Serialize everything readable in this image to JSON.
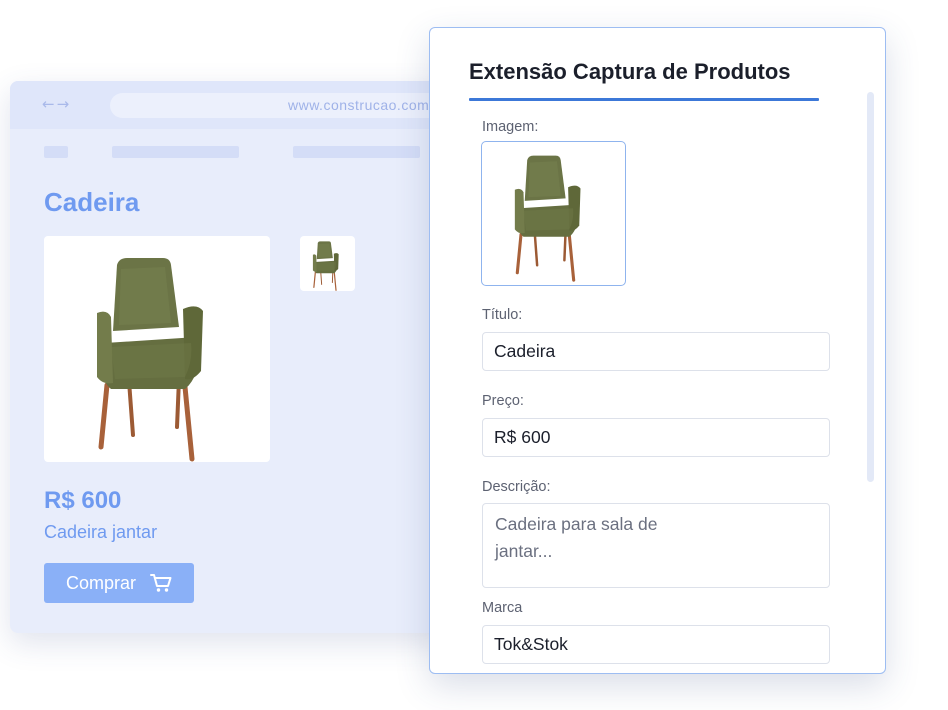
{
  "browser": {
    "nav_arrows": "←→",
    "url": "www.construcao.com",
    "product": {
      "title": "Cadeira",
      "price": "R$ 600",
      "subtitle": "Cadeira jantar",
      "buy_label": "Comprar"
    }
  },
  "extension": {
    "title": "Extensão Captura de Produtos",
    "fields": {
      "image_label": "Imagem:",
      "title_label": "Título:",
      "title_value": "Cadeira",
      "price_label": "Preço:",
      "price_value": "R$ 600",
      "description_label": "Descrição:",
      "description_value": "Cadeira para sala de\njantar...",
      "brand_label": "Marca",
      "brand_value": "Tok&Stok"
    }
  },
  "colors": {
    "accent": "#3c78d8",
    "browser_text": "#6f9af0",
    "chair": "#6b7446",
    "chair_legs": "#a05a32"
  },
  "icons": {
    "cart": "shopping-cart-icon",
    "arrows": "back-forward-arrows-icon"
  }
}
